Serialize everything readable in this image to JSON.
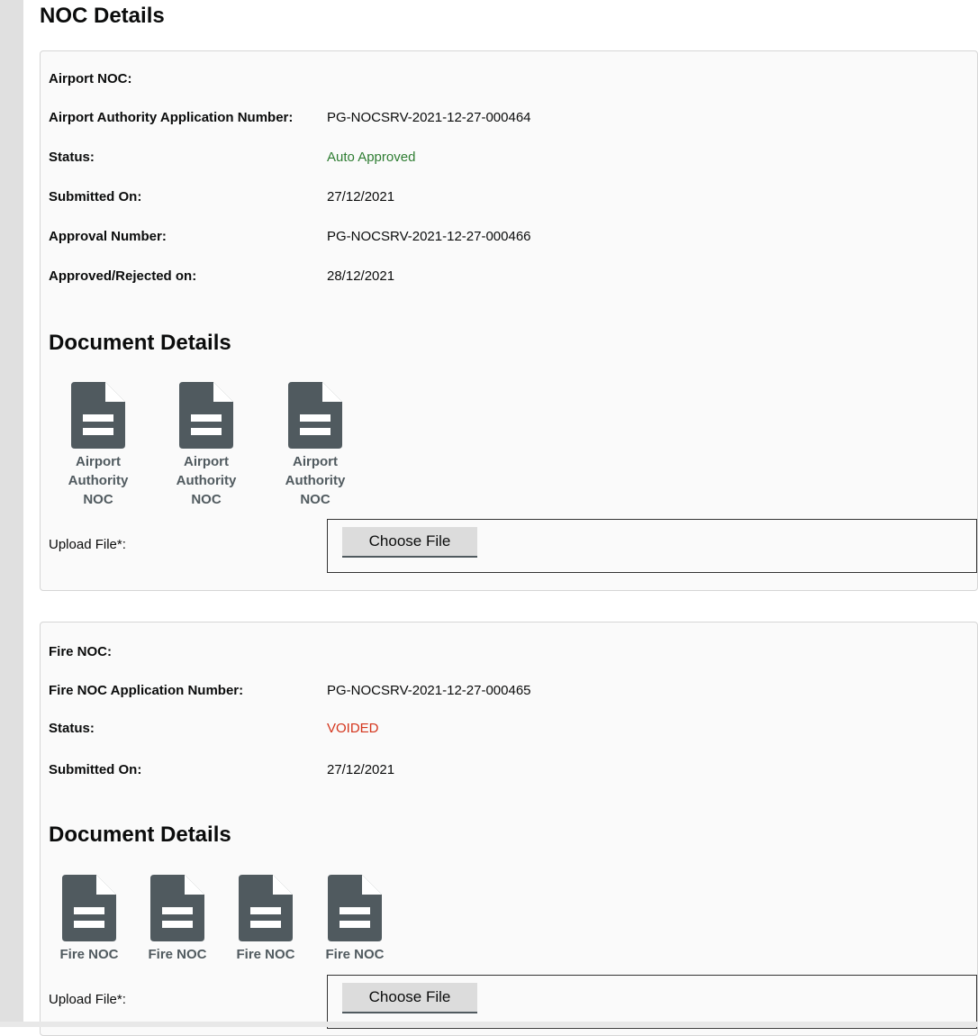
{
  "page_title": "NOC Details",
  "airport_noc": {
    "section_title": "Airport NOC:",
    "rows": [
      {
        "label": "Airport Authority Application Number:",
        "value": "PG-NOCSRV-2021-12-27-000464"
      },
      {
        "label": "Status:",
        "value": "Auto Approved"
      },
      {
        "label": "Submitted On:",
        "value": "27/12/2021"
      },
      {
        "label": "Approval Number:",
        "value": "PG-NOCSRV-2021-12-27-000466"
      },
      {
        "label": "Approved/Rejected on:",
        "value": "28/12/2021"
      }
    ],
    "status_color": "#2e7d32",
    "document_heading": "Document Details",
    "documents": [
      {
        "label": "Airport Authority NOC",
        "icon": "document-icon"
      },
      {
        "label": "Airport Authority NOC",
        "icon": "document-icon"
      },
      {
        "label": "Airport Authority NOC",
        "icon": "document-icon"
      }
    ],
    "upload_label": "Upload File*:",
    "choose_file_label": "Choose File"
  },
  "fire_noc": {
    "section_title": "Fire NOC:",
    "rows": [
      {
        "label": "Fire NOC Application Number:",
        "value": "PG-NOCSRV-2021-12-27-000465"
      },
      {
        "label": "Status:",
        "value": "VOIDED"
      },
      {
        "label": "Submitted On:",
        "value": "27/12/2021"
      }
    ],
    "status_color": "#d4351c",
    "document_heading": "Document Details",
    "documents": [
      {
        "label": "Fire NOC",
        "icon": "document-icon"
      },
      {
        "label": "Fire NOC",
        "icon": "document-icon"
      },
      {
        "label": "Fire NOC",
        "icon": "document-icon"
      },
      {
        "label": "Fire NOC",
        "icon": "document-icon"
      }
    ],
    "upload_label": "Upload File*:",
    "choose_file_label": "Choose File"
  },
  "colors": {
    "doc_icon": "#505a5f",
    "card_bg": "#fafafa",
    "sidebar": "#e0e0e0"
  }
}
